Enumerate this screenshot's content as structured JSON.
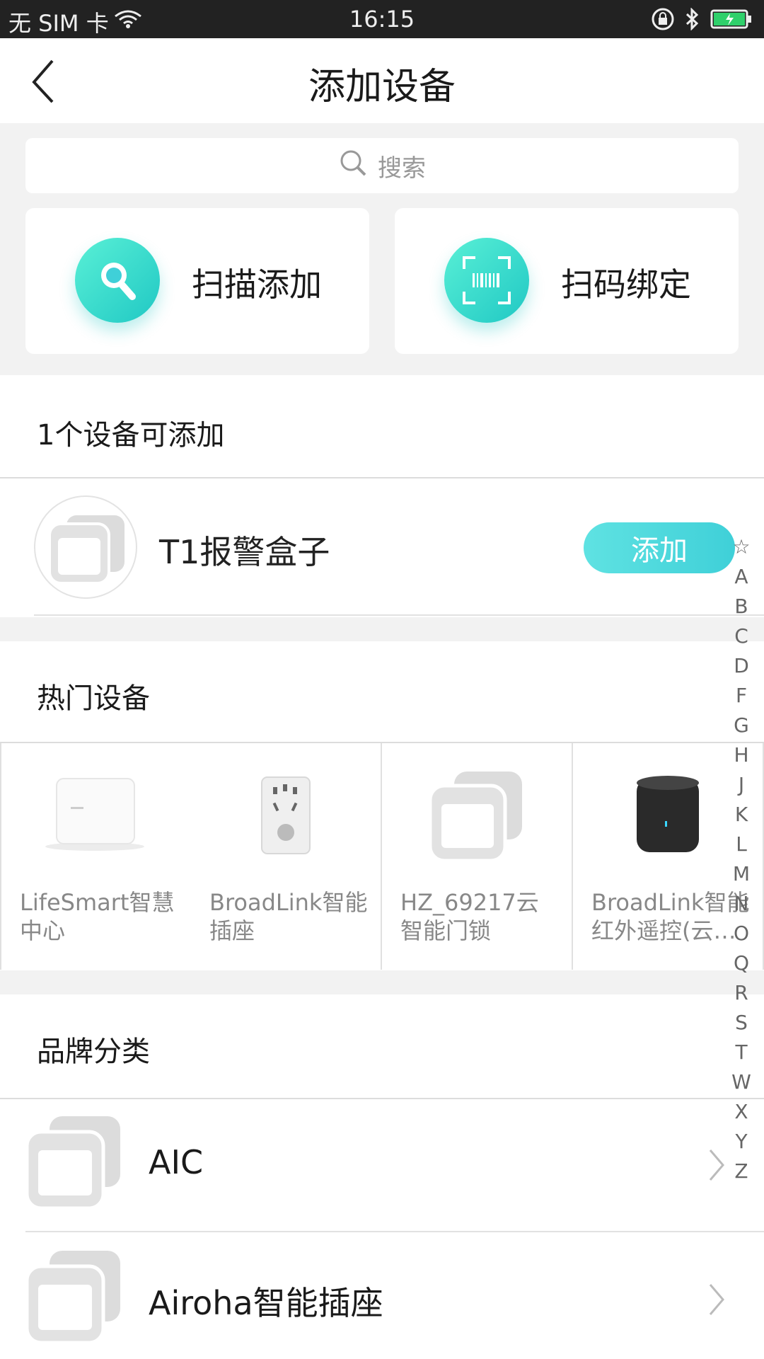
{
  "status": {
    "carrier": "无 SIM 卡",
    "time": "16:15",
    "icons": [
      "wifi-icon",
      "lock-rotation-icon",
      "bluetooth-icon",
      "battery-charging-icon"
    ]
  },
  "header": {
    "title": "添加设备",
    "back_icon": "back-arrow-icon"
  },
  "search": {
    "placeholder": "搜索",
    "icon": "search-icon"
  },
  "quick_actions": [
    {
      "label": "扫描添加",
      "icon": "magnifier-icon"
    },
    {
      "label": "扫码绑定",
      "icon": "barcode-scan-icon"
    }
  ],
  "available": {
    "title": "1个设备可添加",
    "devices": [
      {
        "name": "T1报警盒子",
        "button": "添加"
      }
    ]
  },
  "popular": {
    "title": "热门设备",
    "items": [
      {
        "line1": "LifeSmart智慧",
        "line2": "中心",
        "image": "lifesmart-hub-image"
      },
      {
        "line1": "BroadLink智能",
        "line2": "插座",
        "image": "smart-socket-image"
      },
      {
        "line1": "HZ_69217云",
        "line2": "智能门锁",
        "image": "placeholder-device-icon"
      },
      {
        "line1": "BroadLink智能",
        "line2": "红外遥控(云…",
        "image": "ir-remote-image"
      }
    ]
  },
  "brands": {
    "title": "品牌分类",
    "items": [
      {
        "name": "AIC"
      },
      {
        "name": "Airoha智能插座"
      }
    ]
  },
  "index_letters": [
    "☆",
    "A",
    "B",
    "C",
    "D",
    "F",
    "G",
    "H",
    "J",
    "K",
    "L",
    "M",
    "N",
    "O",
    "Q",
    "R",
    "S",
    "T",
    "W",
    "X",
    "Y",
    "Z"
  ],
  "colors": {
    "accent": "#3fd0d8",
    "accent_light": "#5fe2e2"
  }
}
